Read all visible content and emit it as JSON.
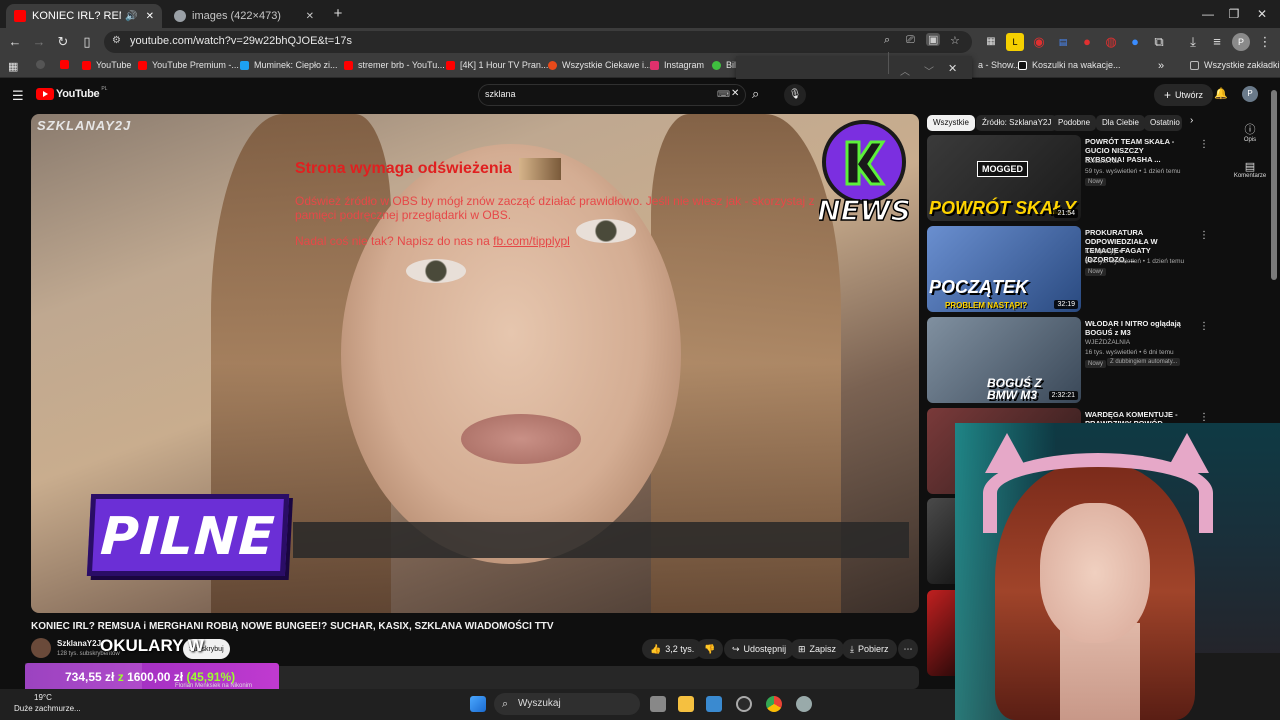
{
  "tabs": [
    {
      "title": "KONIEC IRL? REMSUA i MERGHANI",
      "active": true,
      "favicon_color": "#ff0000"
    },
    {
      "title": "images (422×473)",
      "active": false,
      "favicon_color": "#9aa0a6"
    }
  ],
  "toolbar": {
    "url": "youtube.com/watch?v=29w22bhQJOE&t=17s"
  },
  "bookmarks": [
    {
      "label": "YouTube",
      "color": "#ff0000"
    },
    {
      "label": "YouTube Premium -...",
      "color": "#ff0000"
    },
    {
      "label": "Muminek: Ciepło zi...",
      "color": "#1da1f2"
    },
    {
      "label": "stremer brb - YouTu...",
      "color": "#ff0000"
    },
    {
      "label": "[4K] 1 Hour TV Pran...",
      "color": "#ff0000"
    },
    {
      "label": "Wszystkie Ciekawe i...",
      "color": "#e84a1a"
    },
    {
      "label": "Instagram",
      "color": "#e1306c"
    },
    {
      "label": "Bil",
      "color": "#3fbf3f"
    },
    {
      "label": "a - Show...",
      "color": "#888888"
    },
    {
      "label": "Koszulki na wakacje...",
      "color": "#111111"
    },
    {
      "label": "Wszystkie zakładki",
      "color": "#aaaaaa"
    }
  ],
  "youtube": {
    "logo_text": "YouTube",
    "logo_region": "PL",
    "search_value": "szklana",
    "create_label": "Utwórz",
    "avatar_letter": "P"
  },
  "player": {
    "channel_watermark": "SZKLANAY2J",
    "news_badge_text": "NEWS",
    "pilne": "PILNE",
    "obs_title": "Strona wymaga odświeżenia",
    "obs_message": "Odśwież źródło w OBS by mógł znów zacząć działać prawidłowo. Jeśli nie wiesz jak - skorzystaj z pamięci podręcznej przeglądarki w OBS.",
    "obs_message2_prefix": "Nadal coś nie tak? Napisz do nas na",
    "obs_link": "fb.com/tipplypl"
  },
  "video": {
    "title": "KONIEC IRL? REMSUA i MERGHANI ROBIĄ NOWE BUNGEE!? SUCHAR, KASIX, SZKLANA WIADOMOŚCI TTV",
    "channel": "SzklanaY2J",
    "subscribers": "128 tys. subskrybentów",
    "subscribe_label": "Subskrybuj",
    "likes": "3,2 tys.",
    "share_label": "Udostępnij",
    "save_label": "Zapisz",
    "download_label": "Pobierz"
  },
  "chips": [
    "Wszystkie",
    "Źródło: SzklanaY2J",
    "Podobne",
    "Dla Ciebie",
    "Ostatnio"
  ],
  "recommendations": [
    {
      "title": "POWRÓT TEAM SKAŁA - GUCIO NISZCZY RYBSONA! PASHA ...",
      "channel": "SzklanaY2J",
      "meta": "59 tys. wyświetleń • 1 dzień temu",
      "badge": "Nowy",
      "duration": "21:54",
      "caption": "POWRÓT SKAŁY",
      "thumb_bg": "#2b2b2b",
      "thumb_label": "MOGGED"
    },
    {
      "title": "PROKURATURA ODPOWIEDZIAŁA W TEMACIE FAGATY (DZORDZO, ...",
      "channel": "Konopskyy ●",
      "meta": "314 tys. wyświetleń • 1 dzień temu",
      "badge": "Nowy",
      "duration": "32:19",
      "caption": "POCZĄTEK",
      "thumb_bg": "#3a6fb0",
      "thumb_label": "PROBLEM NASTĄPI?"
    },
    {
      "title": "WŁODAR I NITRO oglądają BOGUŚ z M3",
      "channel": "WJEŻDŻALNIA",
      "meta": "16 tys. wyświetleń • 6 dni temu",
      "badge": "Nowy",
      "badge2": "Z dubbingiem automaty...",
      "duration": "2:32:21",
      "caption": "BOGUŚ Z BMW M3",
      "thumb_bg": "#5a6a7a",
      "thumb_label": ""
    },
    {
      "title": "WARDĘGA KOMENTUJE - PRAWDZIWY POWÓD OBSESJI ...",
      "channel": "",
      "meta": "",
      "badge": "",
      "duration": "",
      "caption": "",
      "thumb_bg": "#4a3030",
      "thumb_label": ""
    }
  ],
  "side_nav": [
    {
      "label": "Opis"
    },
    {
      "label": "Komentarze"
    }
  ],
  "overlay": {
    "okulary": "OKULARY W",
    "donation_current": "734,55 zł",
    "donation_sep": "z",
    "donation_goal": "1600,00 zł",
    "donation_pct": "(45,91%)",
    "donation_fraction": 0.4591,
    "donation_sub": "Florian Menksiek na Nikonim"
  },
  "taskbar": {
    "temperature": "19°C",
    "weather": "Duże zachmurze...",
    "search_placeholder": "Wyszukaj"
  },
  "colors": {
    "accent": "#ff0000",
    "pilne_purple": "#6b2fd6",
    "donation_green": "#9cff2e",
    "obs_red": "#e02020"
  }
}
